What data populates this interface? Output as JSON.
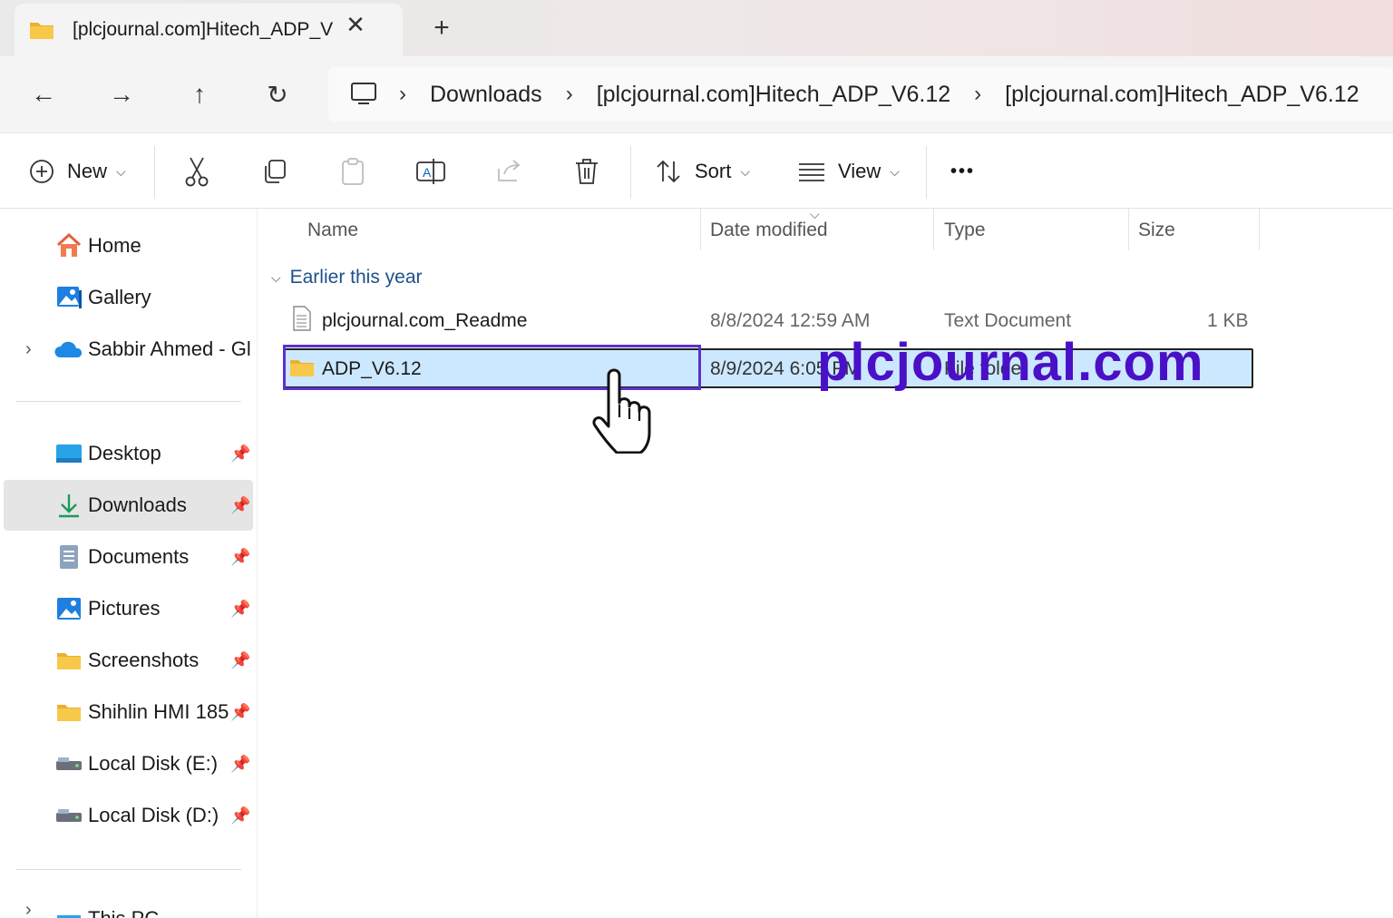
{
  "tab": {
    "title": "[plcjournal.com]Hitech_ADP_V",
    "close_glyph": "✕",
    "new_tab_glyph": "+"
  },
  "nav": {
    "back": "←",
    "forward": "→",
    "up": "↑",
    "refresh": "↻"
  },
  "breadcrumb": {
    "items": [
      "Downloads",
      "[plcjournal.com]Hitech_ADP_V6.12",
      "[plcjournal.com]Hitech_ADP_V6.12"
    ],
    "separator": "›"
  },
  "toolbar": {
    "new_label": "New",
    "sort_label": "Sort",
    "view_label": "View",
    "more": "•••"
  },
  "sidebar": {
    "top": [
      {
        "label": "Home",
        "icon": "home-icon"
      },
      {
        "label": "Gallery",
        "icon": "gallery-icon"
      },
      {
        "label": "Sabbir Ahmed - Gl",
        "icon": "onedrive-icon"
      }
    ],
    "quick": [
      {
        "label": "Desktop",
        "icon": "desktop-icon"
      },
      {
        "label": "Downloads",
        "icon": "downloads-icon",
        "selected": true
      },
      {
        "label": "Documents",
        "icon": "documents-icon"
      },
      {
        "label": "Pictures",
        "icon": "pictures-icon"
      },
      {
        "label": "Screenshots",
        "icon": "folder-icon"
      },
      {
        "label": "Shihlin HMI 185",
        "icon": "folder-icon"
      },
      {
        "label": "Local Disk (E:)",
        "icon": "drive-icon"
      },
      {
        "label": "Local Disk (D:)",
        "icon": "drive-icon"
      }
    ],
    "bottom": {
      "label": "This PC"
    }
  },
  "columns": {
    "name": "Name",
    "date": "Date modified",
    "type": "Type",
    "size": "Size"
  },
  "group": {
    "label": "Earlier this year"
  },
  "files": [
    {
      "name": "plcjournal.com_Readme",
      "date": "8/8/2024 12:59 AM",
      "type": "Text Document",
      "size": "1 KB"
    },
    {
      "name": "ADP_V6.12",
      "date": "8/9/2024 6:05 PM",
      "type": "File folder",
      "size": ""
    }
  ],
  "watermark": "plcjournal.com",
  "colors": {
    "accent": "#0067c0",
    "selection": "#cce8ff",
    "highlight_box": "#5b2fd0",
    "watermark": "#4a10c8",
    "folder": "#f8c84a"
  }
}
